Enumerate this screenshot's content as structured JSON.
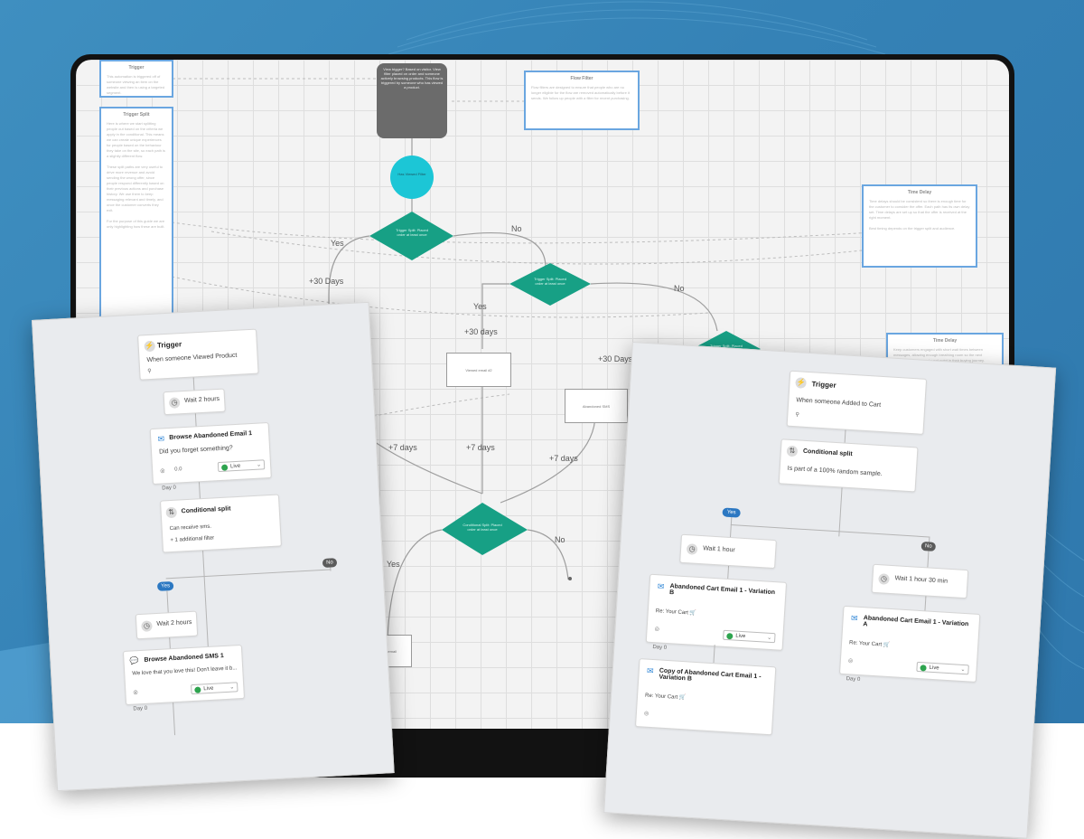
{
  "colors": {
    "background": "#3582b6",
    "canvas": "#f3f3f3",
    "note_border": "#6aa6e0",
    "diamond": "#17a085",
    "circle": "#1cc6d6",
    "dark_box": "#6b6b6b",
    "live_dot": "#2ea44f",
    "yes_pill": "#2c78c2",
    "no_pill": "#5b5b5b"
  },
  "icons": [
    "trigger-icon",
    "clock-icon",
    "email-icon",
    "split-icon",
    "sms-icon",
    "dropdown-chevron-icon"
  ],
  "canvas": {
    "notes": [
      {
        "title": "Trigger",
        "body": "This automation is triggered off of someone viewing an item on the website and then is using a targeted segment."
      },
      {
        "title": "Trigger Split",
        "body": "Here is where we start splitting people out based on the criteria we apply in the conditional. This means we can create unique experiences for people based on the behaviour they take on the site, so each path is a slightly different flow.\n\nThese split paths are very useful to drive more revenue and avoid sending the wrong offer, since people respond differently based on their previous actions and purchase history. We use them to keep messaging relevant and timely, and once the customer converts they exit.\n\nFor the purpose of this guide we are only highlighting how these are built."
      },
      {
        "title": "Flow Filter",
        "body": "Flow filters are designed to ensure that people who are no longer eligible for the flow are removed automatically before it sends. We follow up people with a filter for recent purchasing."
      },
      {
        "title": "Time Delay",
        "body": "Time delays should be consistent so there is enough time for the customer to consider the offer. Each path has its own delay set. Time delays are set up so that the offer is received at the right moment.\n\nBest timing depends on the trigger split and audience."
      },
      {
        "title": "Time Delay",
        "body": "Keep customers engaged with short wait times between messages, allowing enough breathing room so the next message lands at a relevant point in their buying journey."
      }
    ],
    "dark_box_text": "View trigger? Based on visitor. View filter placed on order and someone actively browsing products. This flow is triggered by someone who has viewed a product.",
    "circle_text": "Has Viewed Filter",
    "diamonds": [
      {
        "text": "Trigger Split: Placed order at least once"
      },
      {
        "text": "Trigger Split: Placed order at least once"
      },
      {
        "text": "Trigger Split: Placed order"
      },
      {
        "text": "Conditional Split: Placed order at least once"
      }
    ],
    "boxes": [
      "Viewed email #1",
      "Viewed email #2",
      "Abandoned SMS",
      "Reminder email"
    ],
    "branch_labels": {
      "yes": "Yes",
      "no": "No"
    },
    "delay_labels": {
      "days30": "+30 Days",
      "days30_lower": "+30 days",
      "days7": "+7 days"
    }
  },
  "left_card": {
    "trigger": {
      "title": "Trigger",
      "subtitle": "When someone Viewed Product"
    },
    "wait1": {
      "label": "Wait 2 hours"
    },
    "email1": {
      "title": "Browse Abandoned Email 1",
      "subtitle": "Did you forget something?",
      "status": "Live",
      "stat": "0.0",
      "day": "Day 0"
    },
    "split": {
      "title": "Conditional split",
      "line1": "Can receive sms.",
      "line2": "+ 1 additional filter"
    },
    "yes": "Yes",
    "no": "No",
    "wait2": {
      "label": "Wait 2 hours"
    },
    "sms1": {
      "title": "Browse Abandoned SMS 1",
      "subtitle": "We love that you love this! Don't leave it b...",
      "status": "Live",
      "day": "Day 0"
    }
  },
  "right_card": {
    "trigger": {
      "title": "Trigger",
      "subtitle": "When someone Added to Cart"
    },
    "split": {
      "title": "Conditional split",
      "subtitle": "Is part of a 100% random sample."
    },
    "yes": "Yes",
    "no": "No",
    "wait_yes": {
      "label": "Wait 1 hour"
    },
    "wait_no": {
      "label": "Wait 1 hour 30 min"
    },
    "email_b": {
      "title": "Abandoned Cart Email 1 - Variation B",
      "subtitle": "Re: Your Cart 🛒",
      "status": "Live",
      "day": "Day 0"
    },
    "email_a": {
      "title": "Abandoned Cart Email 1 - Variation A",
      "subtitle": "Re: Your Cart 🛒",
      "status": "Live",
      "day": "Day 0"
    },
    "email_copy": {
      "title": "Copy of Abandoned Cart Email 1 - Variation B",
      "subtitle": "Re: Your Cart 🛒"
    }
  }
}
